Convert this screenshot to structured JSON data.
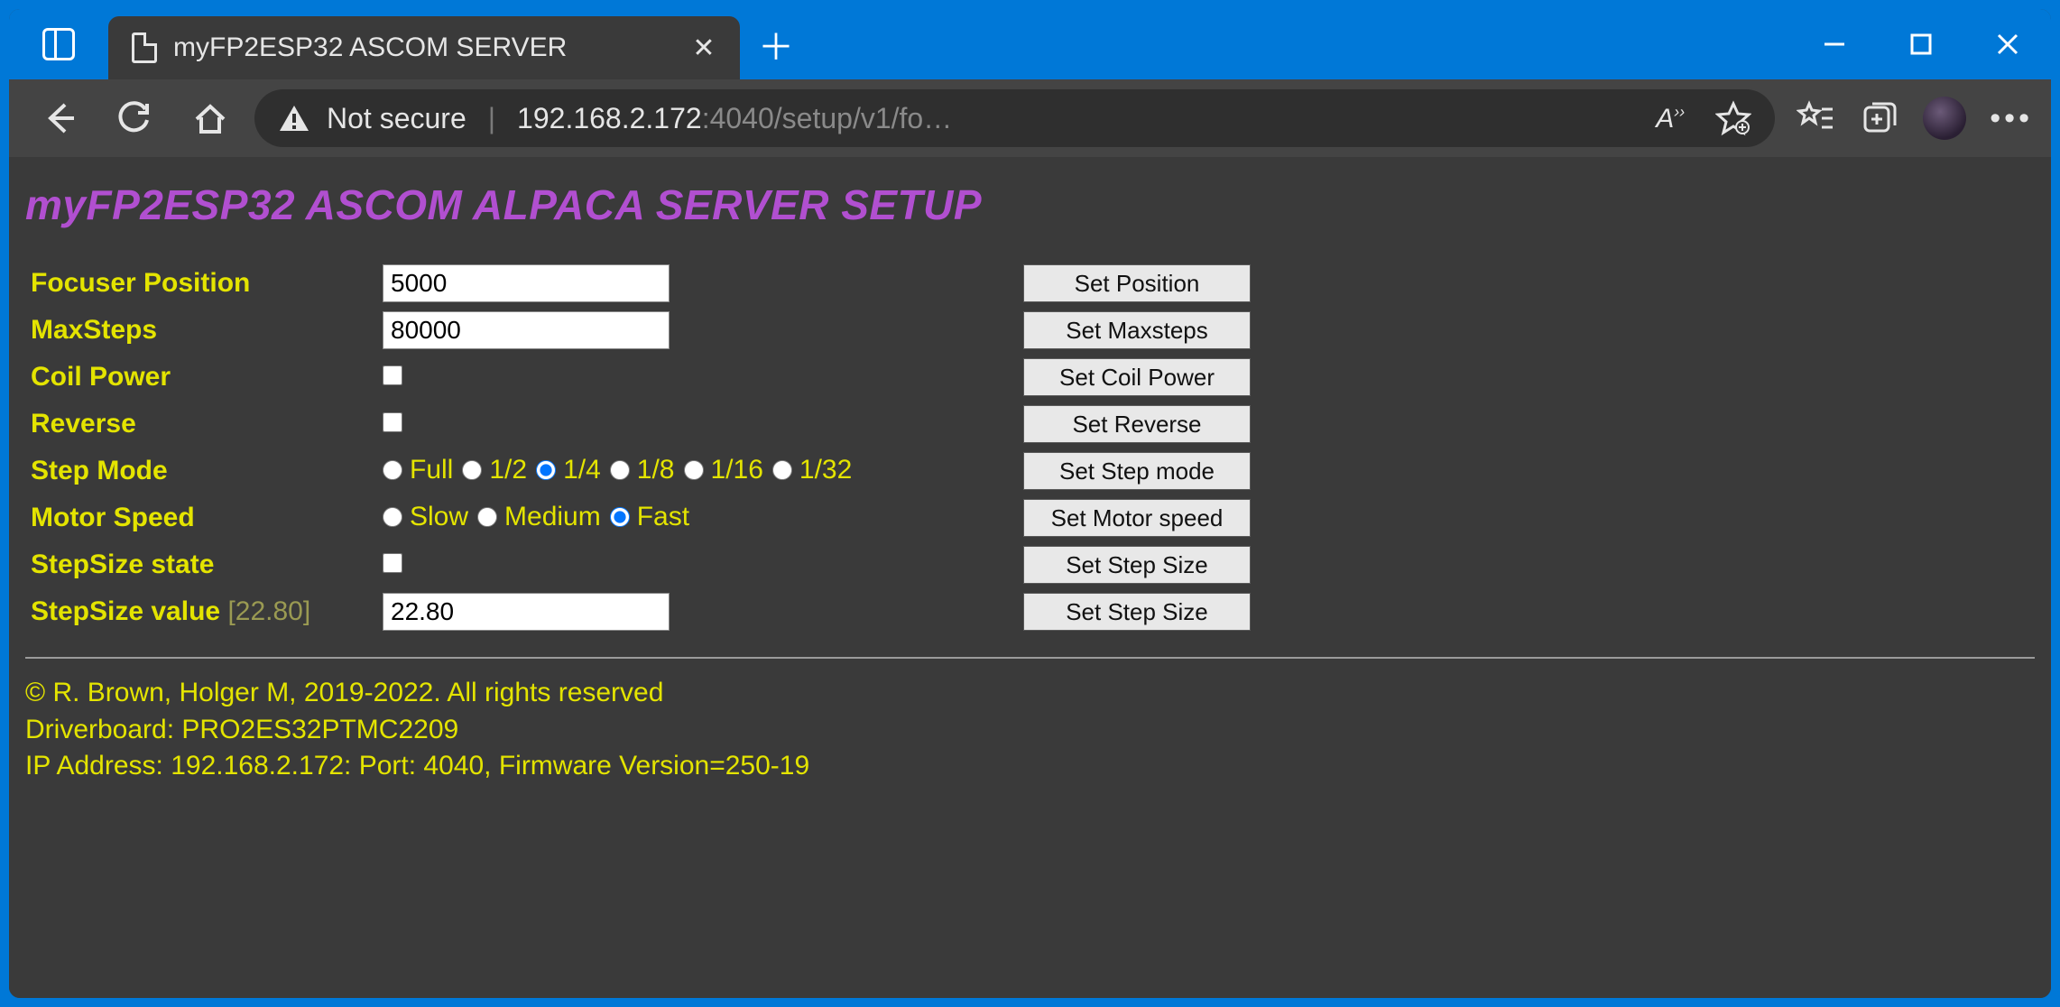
{
  "window": {
    "tab_title": "myFP2ESP32 ASCOM SERVER",
    "not_secure": "Not secure",
    "url_host": "192.168.2.172",
    "url_rest": ":4040/setup/v1/fo…",
    "read_aloud": "A))"
  },
  "page": {
    "title": "myFP2ESP32 ASCOM ALPACA SERVER SETUP"
  },
  "labels": {
    "focuser_position": "Focuser Position",
    "maxsteps": "MaxSteps",
    "coil_power": "Coil Power",
    "reverse": "Reverse",
    "step_mode": "Step Mode",
    "motor_speed": "Motor Speed",
    "stepsize_state": "StepSize state",
    "stepsize_value": "StepSize value",
    "stepsize_value_suffix": "[22.80]"
  },
  "values": {
    "focuser_position": "5000",
    "maxsteps": "80000",
    "coil_power_checked": false,
    "reverse_checked": false,
    "stepsize_state_checked": false,
    "stepsize_value": "22.80"
  },
  "stepmode": {
    "options": [
      "Full",
      "1/2",
      "1/4",
      "1/8",
      "1/16",
      "1/32"
    ],
    "selected": "1/4"
  },
  "motorspeed": {
    "options": [
      "Slow",
      "Medium",
      "Fast"
    ],
    "selected": "Fast"
  },
  "buttons": {
    "set_position": "Set Position",
    "set_maxsteps": "Set Maxsteps",
    "set_coil_power": "Set Coil Power",
    "set_reverse": "Set Reverse",
    "set_step_mode": "Set Step mode",
    "set_motor_speed": "Set Motor speed",
    "set_step_size_state": "Set Step Size",
    "set_step_size_value": "Set Step Size"
  },
  "footer": {
    "copyright": "© R. Brown, Holger M, 2019-2022. All rights reserved",
    "driverboard": "Driverboard: PRO2ES32PTMC2209",
    "ipinfo": "IP Address: 192.168.2.172: Port: 4040, Firmware Version=250-19"
  }
}
